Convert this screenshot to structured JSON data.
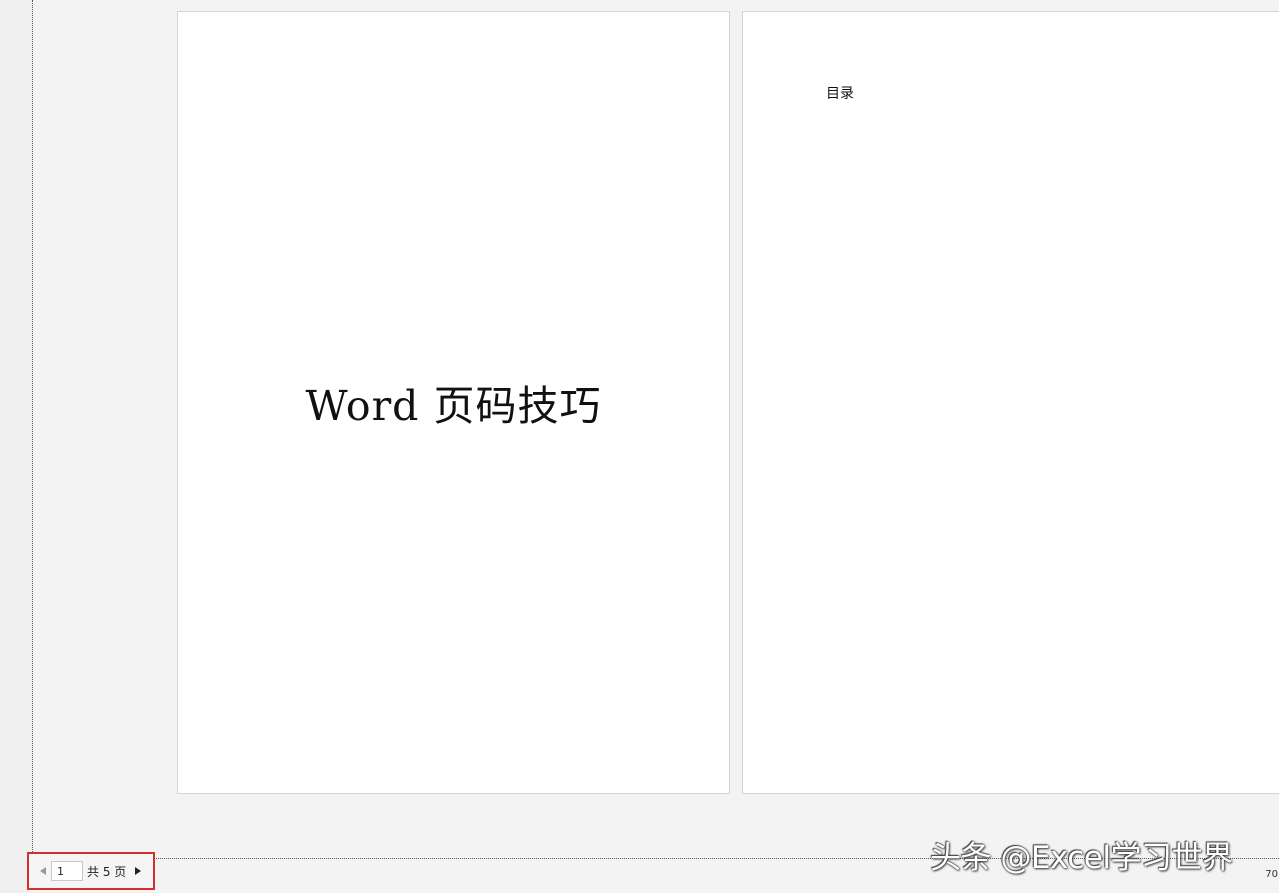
{
  "pages": [
    {
      "title": "Word 页码技巧"
    },
    {
      "heading": "目录"
    }
  ],
  "pager": {
    "current_page": "1",
    "total_label": "共 5 页",
    "prev_icon": "triangle-left-icon",
    "next_icon": "triangle-right-icon"
  },
  "status": {
    "zoom": "70"
  },
  "watermark": {
    "text": "头条 @Excel学习世界"
  },
  "colors": {
    "highlight_box": "#d32f2f",
    "workspace_bg": "#f3f3f3",
    "page_bg": "#ffffff"
  }
}
